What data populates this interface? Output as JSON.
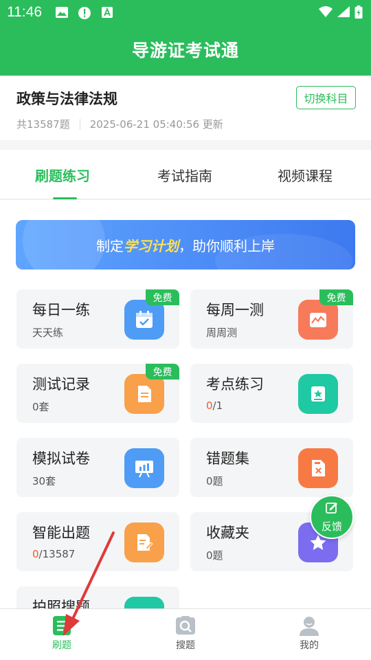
{
  "status_bar": {
    "time": "11:46"
  },
  "header": {
    "title": "导游证考试通"
  },
  "subject": {
    "name": "政策与法律法规",
    "count": "共13587题",
    "updated": "2025-06-21 05:40:56 更新",
    "switch_label": "切换科目"
  },
  "tabs": [
    {
      "label": "刷题练习"
    },
    {
      "label": "考试指南"
    },
    {
      "label": "视频课程"
    }
  ],
  "banner": {
    "prefix": "制定",
    "highlight": "学习计划",
    "suffix": "，助你顺利上岸"
  },
  "cards": [
    {
      "title": "每日一练",
      "sub": "天天练",
      "badge": "免费",
      "icon": "calendar-icon",
      "color": "#4e9cf5"
    },
    {
      "title": "每周一测",
      "sub": "周周测",
      "badge": "免费",
      "icon": "chart-icon",
      "color": "#f77a5a"
    },
    {
      "title": "测试记录",
      "sub": "0套",
      "badge": "免费",
      "icon": "document-icon",
      "color": "#f9a04b"
    },
    {
      "title": "考点练习",
      "sub_done": "0",
      "sub_total": "/1",
      "icon": "star-book-icon",
      "color": "#1fc9a4"
    },
    {
      "title": "模拟试卷",
      "sub": "30套",
      "icon": "presentation-icon",
      "color": "#4e9cf5"
    },
    {
      "title": "错题集",
      "sub": "0题",
      "icon": "error-file-icon",
      "color": "#f77a45"
    },
    {
      "title": "智能出题",
      "sub_done": "0",
      "sub_total": "/13587",
      "icon": "edit-doc-icon",
      "color": "#f9a04b"
    },
    {
      "title": "收藏夹",
      "sub": "0题",
      "icon": "star-folder-icon",
      "color": "#7b6cf0"
    },
    {
      "title": "拍照搜题",
      "icon": "camera-icon",
      "color": "#1fc9a4"
    }
  ],
  "feedback": {
    "label": "反馈"
  },
  "bottom_nav": [
    {
      "label": "刷题",
      "icon": "practice-icon"
    },
    {
      "label": "搜题",
      "icon": "search-photo-icon"
    },
    {
      "label": "我的",
      "icon": "profile-icon"
    }
  ],
  "colors": {
    "brand": "#2bbd5c",
    "accent_red": "#f05a28",
    "annotation_arrow": "#e03a3a"
  }
}
